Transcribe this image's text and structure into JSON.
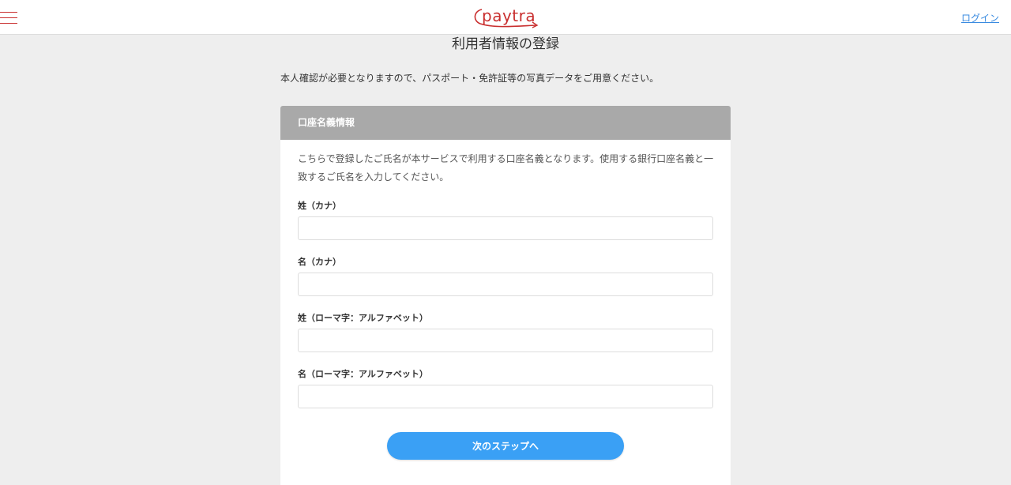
{
  "header": {
    "logo_text": "paytra",
    "login_label": "ログイン",
    "menu_icon": "hamburger-menu-icon"
  },
  "page": {
    "title": "利用者情報の登録",
    "intro": "本人確認が必要となりますので、パスポート・免許証等の写真データをご用意ください。"
  },
  "card": {
    "title": "口座名義情報",
    "description": "こちらで登録したご氏名が本サービスで利用する口座名義となります。使用する銀行口座名義と一致するご氏名を入力してください。",
    "fields": [
      {
        "label": "姓（カナ）",
        "value": "",
        "placeholder": ""
      },
      {
        "label": "名（カナ）",
        "value": "",
        "placeholder": ""
      },
      {
        "label": "姓（ローマ字：アルファベット）",
        "value": "",
        "placeholder": ""
      },
      {
        "label": "名（ローマ字：アルファベット）",
        "value": "",
        "placeholder": ""
      }
    ],
    "next_button_label": "次のステップへ"
  },
  "colors": {
    "brand": "#c92f2f",
    "link": "#3a8be0",
    "card_header_bg": "#a9a9a9",
    "button_bg": "#3aa0f5",
    "page_bg": "#eeeeee"
  }
}
